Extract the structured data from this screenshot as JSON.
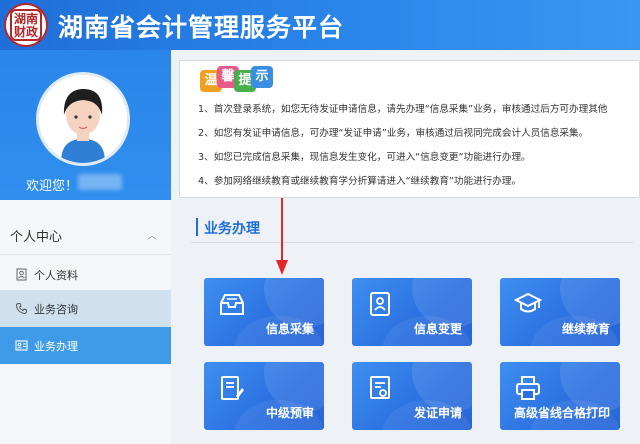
{
  "header": {
    "title": "湖南省会计管理服务平台"
  },
  "sidebar": {
    "welcome": "欢迎您！",
    "menu_head": "个人中心",
    "items": [
      {
        "label": "个人资料",
        "icon": "profile-icon"
      },
      {
        "label": "业务咨询",
        "icon": "phone-icon"
      },
      {
        "label": "业务办理",
        "icon": "id-card-icon"
      }
    ]
  },
  "notice": {
    "banner": [
      "温",
      "馨",
      "提",
      "示"
    ],
    "lines": [
      "1、首次登录系统，如您无待发证申请信息，请先办理“信息采集”业务，审核通过后方可办理其他",
      "2、如您有发证申请信息，可办理“发证申请”业务，审核通过后视同完成会计人员信息采集。",
      "3、如您已完成信息采集，现信息发生变化，可进入“信息变更”功能进行办理。",
      "4、参加网络继续教育或继续教育学分折算请进入“继续教育”功能进行办理。"
    ]
  },
  "business": {
    "title": "业务办理",
    "tiles": [
      {
        "label": "信息采集",
        "icon": "inbox-icon"
      },
      {
        "label": "信息变更",
        "icon": "person-card-icon"
      },
      {
        "label": "继续教育",
        "icon": "graduation-cap-icon"
      },
      {
        "label": "中级预审",
        "icon": "document-edit-icon"
      },
      {
        "label": "发证申请",
        "icon": "certificate-icon"
      },
      {
        "label": "高级省线合格打印",
        "icon": "printer-icon"
      }
    ]
  },
  "colors": {
    "brand": "#1f6fd8",
    "accent_arrow": "#e0272a",
    "menu_active": "#3f9ae8"
  }
}
